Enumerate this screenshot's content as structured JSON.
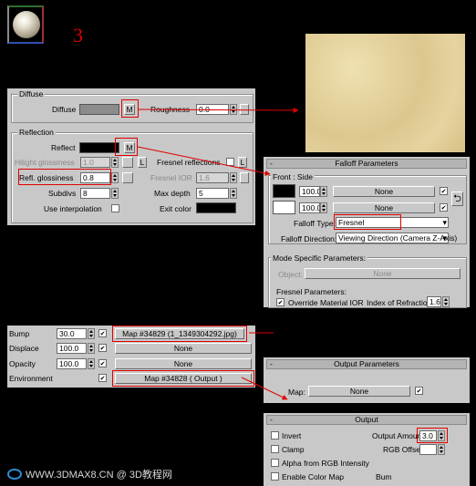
{
  "step_number": "3",
  "watermark": {
    "text": "WWW.3DMAX8.CN @ 3D教程网"
  },
  "colors": {
    "accent_red": "#e00000",
    "panel_bg": "#c8c8c8",
    "texture": "#e2cf9a"
  },
  "diffuse": {
    "group_title": "Diffuse",
    "diffuse_label": "Diffuse",
    "map_button": "M",
    "roughness_label": "Roughness",
    "roughness_value": "0.0"
  },
  "reflection": {
    "group_title": "Reflection",
    "reflect_label": "Reflect",
    "map_button": "M",
    "hilight_label": "Hilight glossiness",
    "hilight_value": "1.0",
    "lock_label": "L",
    "fresnel_label": "Fresnel reflections",
    "refl_gloss_label": "Refl. glossiness",
    "refl_gloss_value": "0.8",
    "fresnel_ior_label": "Fresnel IOR",
    "fresnel_ior_value": "1.6",
    "subdivs_label": "Subdivs",
    "subdivs_value": "8",
    "max_depth_label": "Max depth",
    "max_depth_value": "5",
    "interp_label": "Use interpolation",
    "exit_label": "Exit color"
  },
  "falloff": {
    "title": "Falloff Parameters",
    "front_side_label": "Front : Side",
    "front_value": "100.0",
    "front_map": "None",
    "side_value": "100.0",
    "side_map": "None",
    "falloff_type_label": "Falloff Type:",
    "falloff_type_value": "Fresnel",
    "falloff_dir_label": "Falloff Direction:",
    "falloff_dir_value": "Viewing Direction (Camera Z-Axis)",
    "mode_label": "Mode Specific Parameters:",
    "object_label": "Object:",
    "object_value": "None",
    "fresnel_params_label": "Fresnel Parameters:",
    "override_label": "Override Material IOR",
    "ior_label": "Index of Refraction",
    "ior_value": "1.6"
  },
  "maps": {
    "bump_label": "Bump",
    "bump_value": "30.0",
    "bump_map": "Map #34829 (1_1349304292.jpg)",
    "displace_label": "Displace",
    "displace_value": "100.0",
    "displace_map": "None",
    "opacity_label": "Opacity",
    "opacity_value": "100.0",
    "opacity_map": "None",
    "env_label": "Environment",
    "env_map": "Map #34828  ( Output )"
  },
  "output_params": {
    "title": "Output Parameters",
    "map_label": "Map:",
    "map_value": "None"
  },
  "output": {
    "title": "Output",
    "invert_label": "Invert",
    "output_amount_label": "Output Amount:",
    "output_amount_value": "3.0",
    "clamp_label": "Clamp",
    "rgb_offset_label": "RGB Offset:",
    "alpha_label": "Alpha from RGB Intensity",
    "enable_label": "Enable Color Map",
    "bump_label": "Bum"
  }
}
